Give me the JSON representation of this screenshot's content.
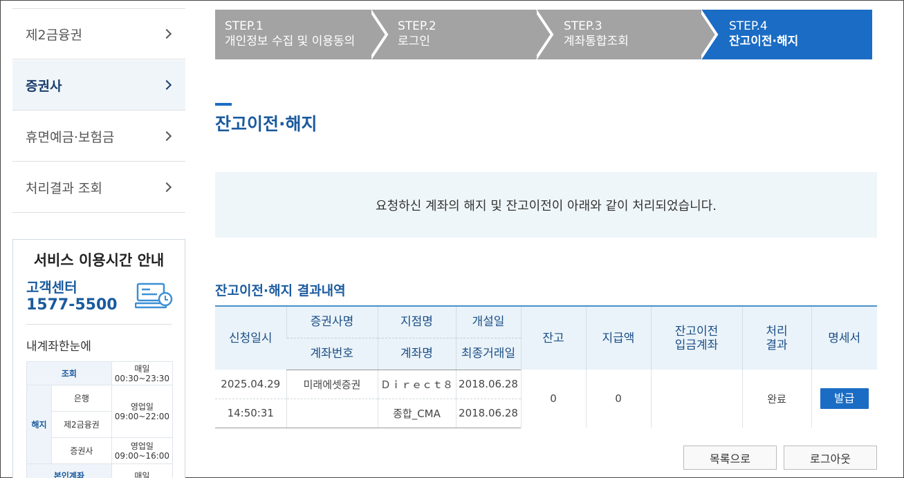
{
  "sidebar": {
    "items": [
      {
        "label": "제2금융권"
      },
      {
        "label": "증권사"
      },
      {
        "label": "휴면예금·보험금"
      },
      {
        "label": "처리결과 조회"
      }
    ]
  },
  "service": {
    "title": "서비스 이용시간 안내",
    "cs_label": "고객센터",
    "cs_number": "1577-5500",
    "sub": "내계좌한눈에",
    "hours": {
      "inquiry_label": "조회",
      "inquiry_time": "매일\n00:30~23:30",
      "cancel_label": "해지",
      "bank_label": "은행",
      "bank_time": "영업일\n09:00~22:00",
      "fin2_label": "제2금융권",
      "sec_label": "증권사",
      "sec_time": "영업일\n09:00~16:00",
      "self_label": "본인계좌",
      "self_time": "매일"
    }
  },
  "steps": [
    {
      "num": "STEP.1",
      "title": "개인정보 수집 및 이용동의"
    },
    {
      "num": "STEP.2",
      "title": "로그인"
    },
    {
      "num": "STEP.3",
      "title": "계좌통합조회"
    },
    {
      "num": "STEP.4",
      "title": "잔고이전·해지"
    }
  ],
  "colors": {
    "step_inactive": "#a3a3a3",
    "step_active": "#1a6cc4",
    "accent": "#1a5a9e"
  },
  "page_title": "잔고이전·해지",
  "notice": "요청하신 계좌의 해지 및 잔고이전이 아래와 같이 처리되었습니다.",
  "section_title": "잔고이전·해지 결과내역",
  "table": {
    "headers": {
      "req_time": "신청일시",
      "company": "증권사명",
      "account_no": "계좌번호",
      "branch": "지점명",
      "account_name": "계좌명",
      "open_date": "개설일",
      "last_trade": "최종거래일",
      "balance": "잔고",
      "paid": "지급액",
      "transfer_l1": "잔고이전",
      "transfer_l2": "입금계좌",
      "result_l1": "처리",
      "result_l2": "결과",
      "statement": "명세서"
    },
    "row": {
      "date": "2025.04.29",
      "time": "14:50:31",
      "company": "미래에셋증권",
      "account_no": "",
      "branch": "Ｄｉｒｅｃｔ８",
      "account_name": "종합_CMA",
      "open_date": "2018.06.28",
      "last_trade": "2018.06.28",
      "balance": "0",
      "paid": "0",
      "transfer_account": "",
      "result": "완료",
      "issue": "발급"
    }
  },
  "buttons": {
    "list": "목록으로",
    "logout": "로그아웃"
  }
}
